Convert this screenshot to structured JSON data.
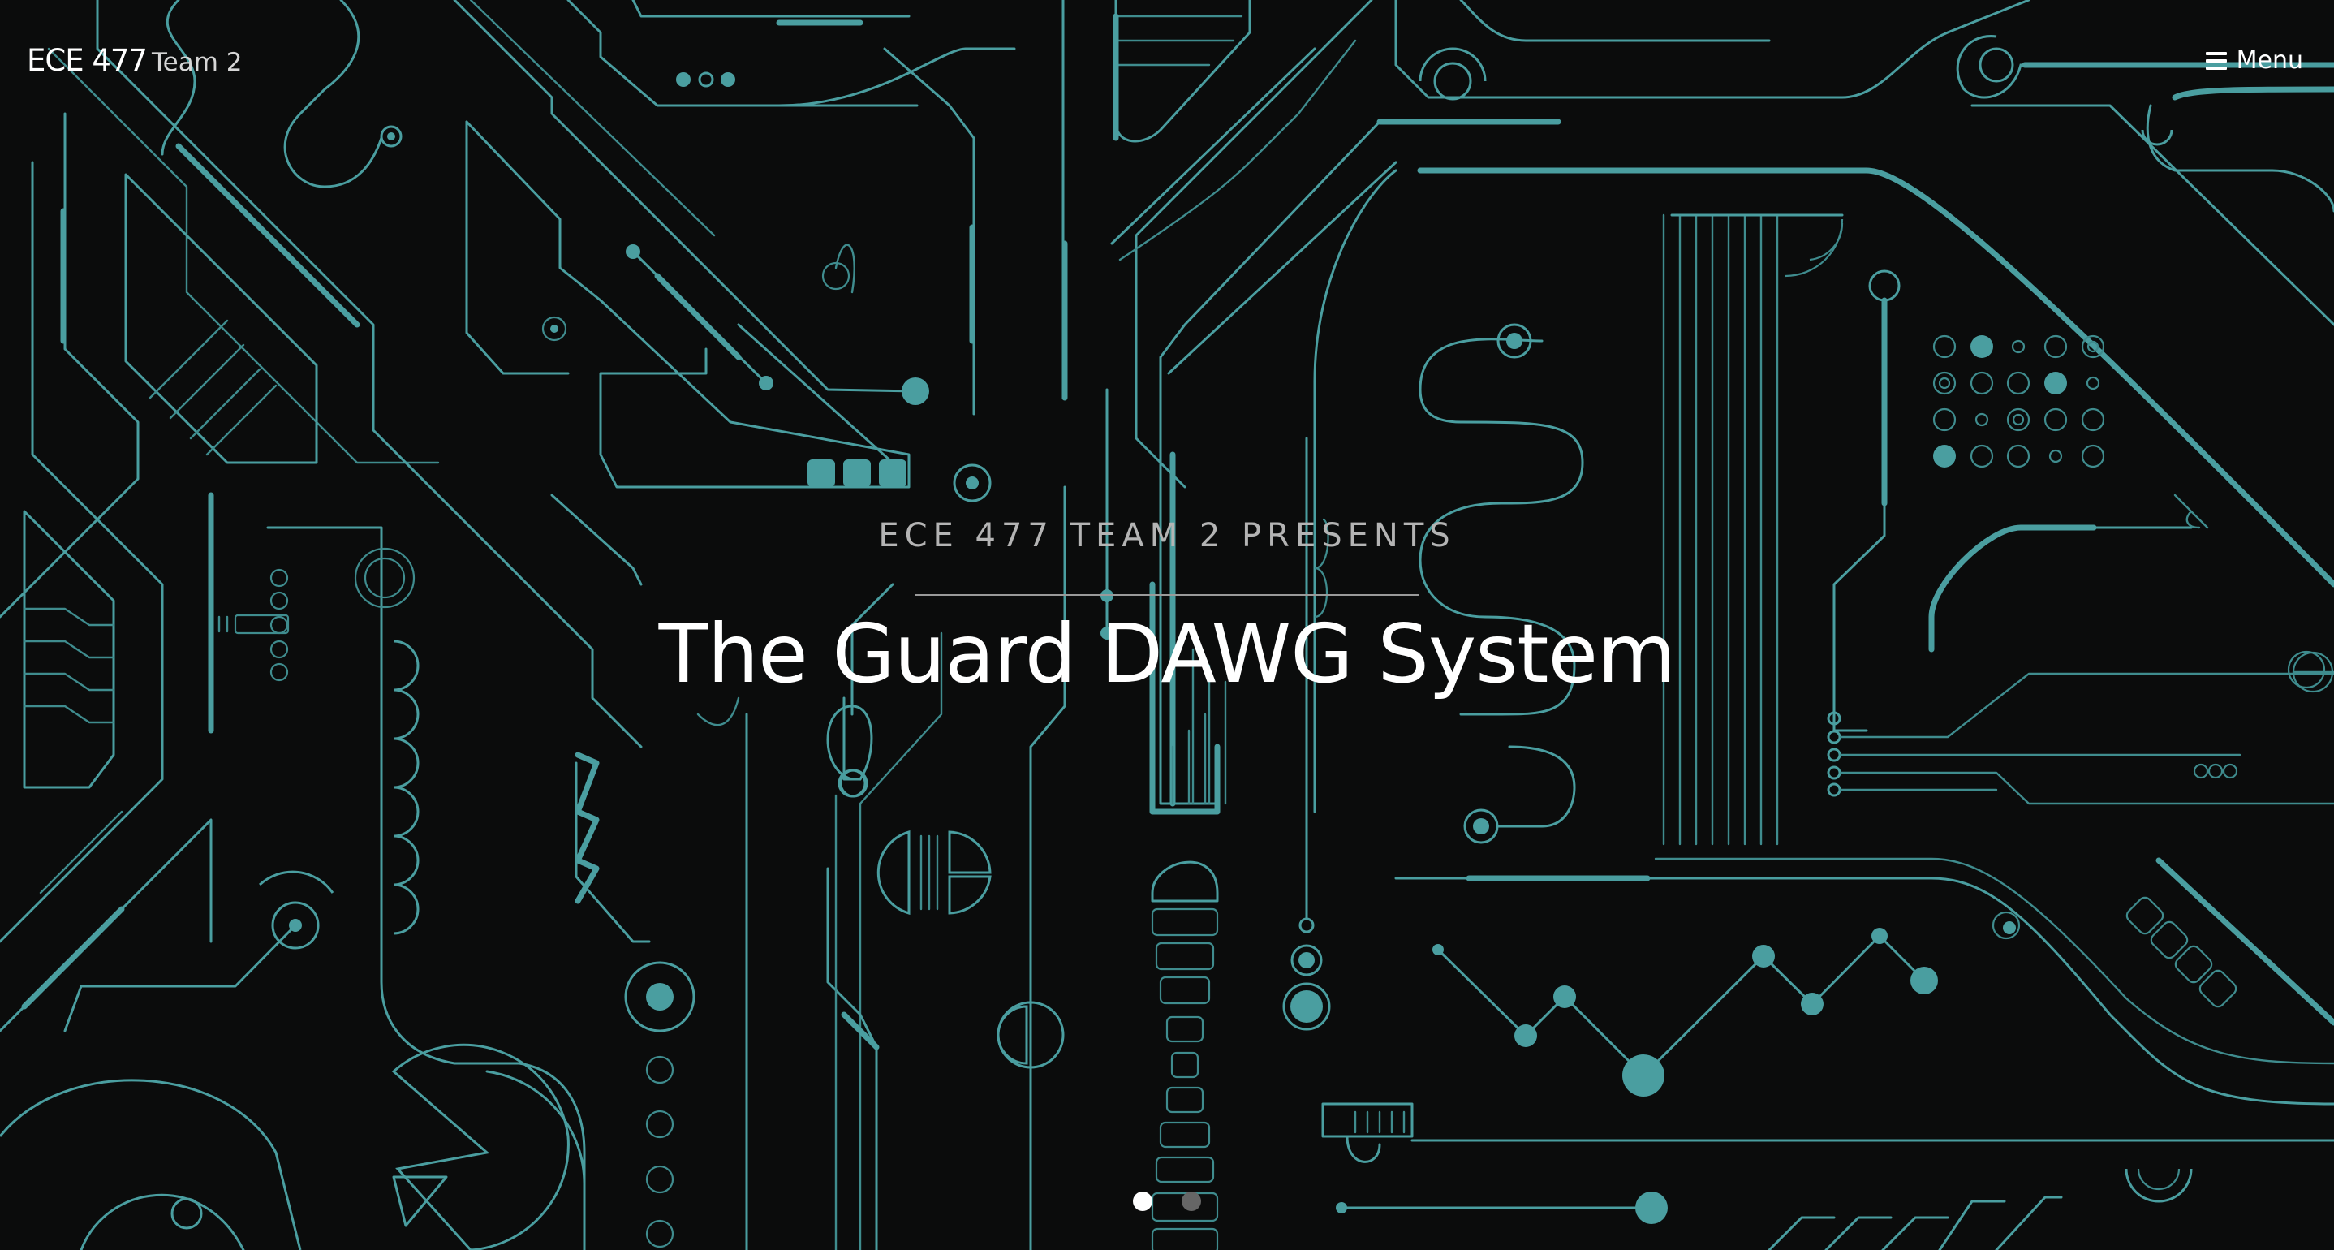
{
  "navbar": {
    "brand_main": "ECE 477",
    "brand_sub": "Team 2",
    "menu_label": "Menu",
    "menu_icon": "hamburger-icon"
  },
  "hero": {
    "kicker": "ECE 477 TEAM 2 PRESENTS",
    "title": "The Guard DAWG System",
    "background": "circuit-board-pattern"
  },
  "carousel": {
    "slide_count": 2,
    "active_slide": 1
  },
  "colors": {
    "background": "#0b0c0c",
    "circuit_trace": "#4a9ea0",
    "text_primary": "#ffffff",
    "text_secondary": "#b4b4b4",
    "dot_inactive": "#666666"
  }
}
